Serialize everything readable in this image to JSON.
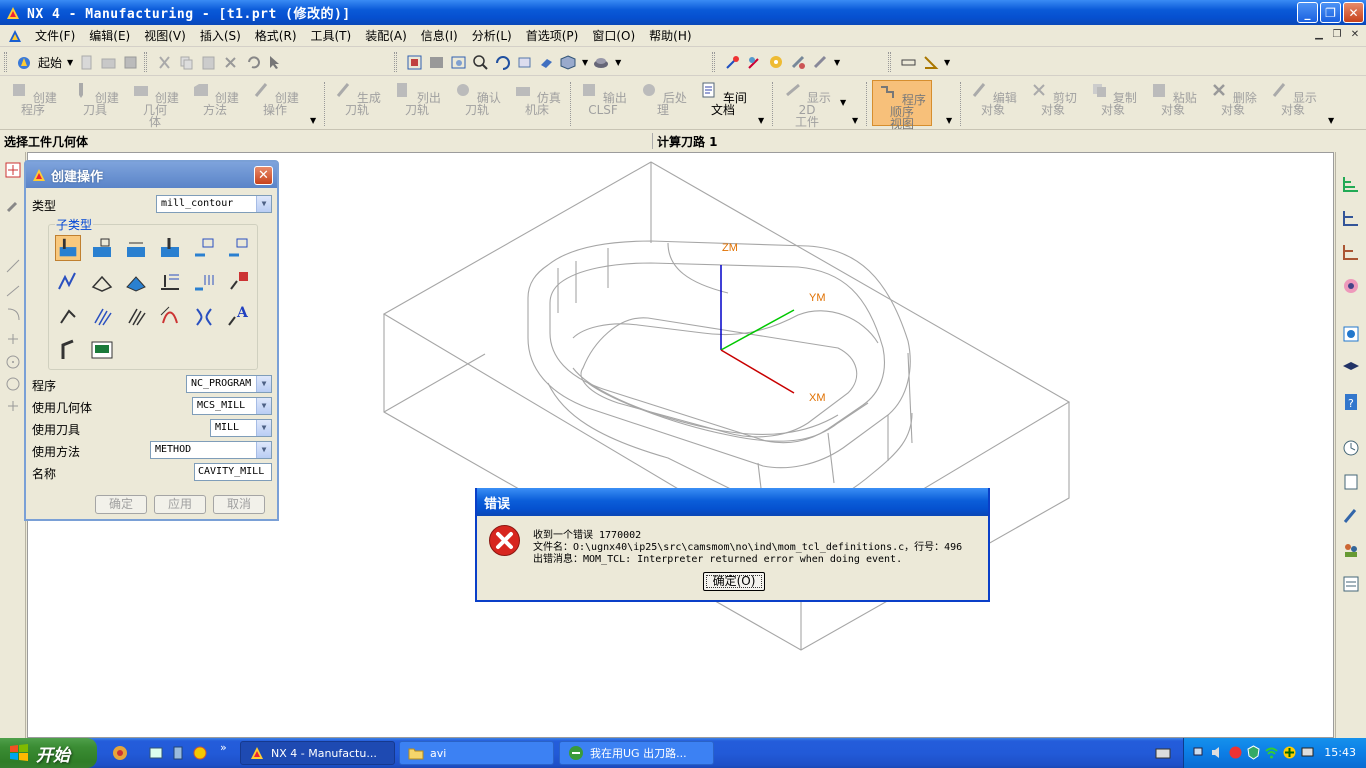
{
  "window": {
    "title": "NX 4 - Manufacturing - [t1.prt (修改的)]",
    "minimize": "_",
    "restore": "❐",
    "close": "✕"
  },
  "menu": {
    "items": [
      "文件(F)",
      "编辑(E)",
      "视图(V)",
      "插入(S)",
      "格式(R)",
      "工具(T)",
      "装配(A)",
      "信息(I)",
      "分析(L)",
      "首选项(P)",
      "窗口(O)",
      "帮助(H)"
    ]
  },
  "toolbar1": {
    "start_label": "起始"
  },
  "toolbar2": {
    "create_program": "创建程序",
    "create_tool": "创建刀具",
    "create_geometry_1": "创建几何",
    "create_geometry_2": "体",
    "create_method": "创建方法",
    "create_operation": "创建操作",
    "generate_toolpath": "生成刀轨",
    "list_toolpath": "列出刀轨",
    "verify_toolpath": "确认刀轨",
    "simulate_machine": "仿真机床",
    "output_clsf_1": "输出",
    "output_clsf_2": "CLSF",
    "postprocess": "后处理",
    "shop_doc": "车间文档",
    "display_2d_1": "显示 2D",
    "display_2d_2": "工件",
    "program_order_1": "程序顺序",
    "program_order_2": "视图",
    "edit_object": "编辑对象",
    "cut_object": "剪切对象",
    "copy_object": "复制对象",
    "paste_object": "粘贴对象",
    "delete_object": "删除对象",
    "display_object": "显示对象"
  },
  "cue": {
    "prompt": "选择工件几何体",
    "status": "计算刀路 1"
  },
  "viewport": {
    "axes": {
      "z": "ZM",
      "y": "YM",
      "x": "XM"
    },
    "colors": {
      "z": "#0000c8",
      "y": "#00c800",
      "x": "#c80000",
      "label": "#e07000",
      "wire": "#a0a0a0"
    }
  },
  "create_dialog": {
    "title": "创建操作",
    "type_label": "类型",
    "type_value": "mill_contour",
    "subtype_label": "子类型",
    "program_label": "程序",
    "program_value": "NC_PROGRAM",
    "geometry_label": "使用几何体",
    "geometry_value": "MCS_MILL",
    "tool_label": "使用刀具",
    "tool_value": "MILL",
    "method_label": "使用方法",
    "method_value": "METHOD",
    "name_label": "名称",
    "name_value": "CAVITY_MILL",
    "ok": "确定",
    "apply": "应用",
    "cancel": "取消"
  },
  "error_dialog": {
    "title": "错误",
    "line1": "收到一个错误 1770002",
    "line2": "文件名：O:\\ugnx40\\ip25\\src\\camsmom\\no\\ind\\mom_tcl_definitions.c，行号：496",
    "line3": "出错消息：MOM_TCL: Interpreter returned error when doing event.",
    "ok": "确定(O)"
  },
  "taskbar": {
    "start": "开始",
    "task1": "NX 4 - Manufactu...",
    "task2": "avi",
    "task3": "我在用UG 出刀路...",
    "clock": "15:43"
  }
}
